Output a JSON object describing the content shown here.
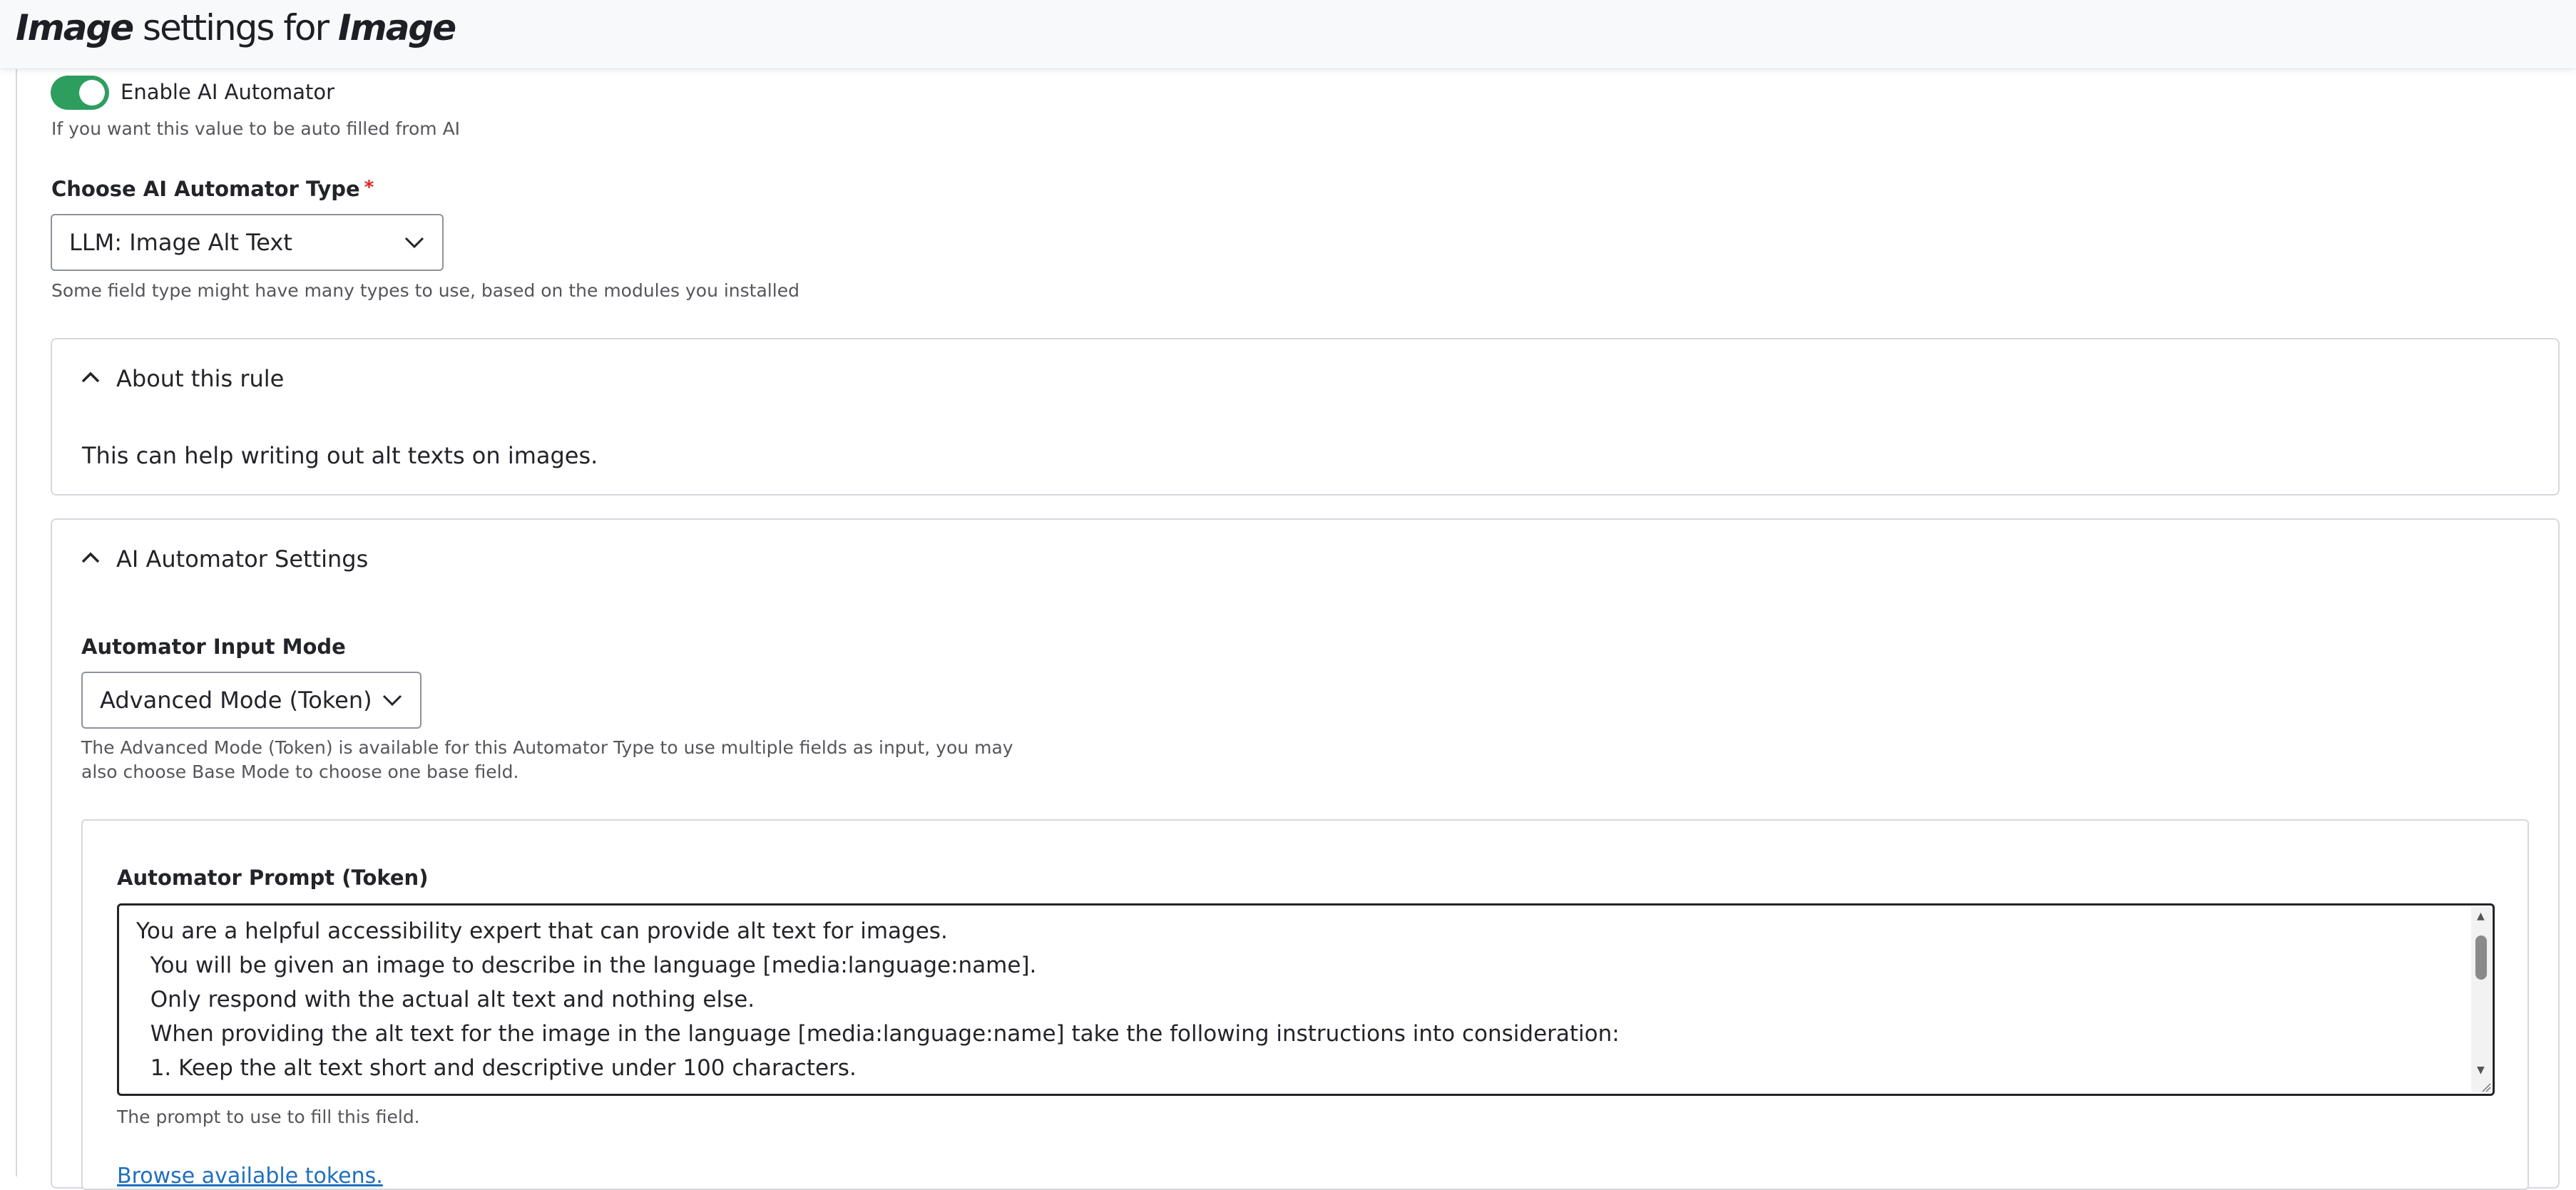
{
  "header": {
    "title_part1": "Image",
    "title_part2": " settings for ",
    "title_part3": "Image"
  },
  "toggle": {
    "label": "Enable AI Automator",
    "state": "on",
    "description": "If you want this value to be auto filled from AI",
    "accent_color": "#2e9e5f"
  },
  "automator_type": {
    "label": "Choose AI Automator Type",
    "required_mark": "*",
    "value": "LLM: Image Alt Text",
    "description": "Some field type might have many types to use, based on the modules you installed"
  },
  "about_rule": {
    "title": "About this rule",
    "body": "This can help writing out alt texts on images."
  },
  "settings": {
    "title": "AI Automator Settings",
    "input_mode_label": "Automator Input Mode",
    "input_mode_value": "Advanced Mode (Token)",
    "input_mode_description_line1": "The Advanced Mode (Token) is available for this Automator Type to use multiple fields as input, you may",
    "input_mode_description_line2": "also choose Base Mode to choose one base field.",
    "prompt_label": "Automator Prompt (Token)",
    "prompt_lines": [
      "You are a helpful accessibility expert that can provide alt text for images.",
      "  You will be given an image to describe in the language [media:language:name].",
      "  Only respond with the actual alt text and nothing else.",
      "  When providing the alt text for the image in the language [media:language:name] take the following instructions into consideration:",
      "  1. Keep the alt text short and descriptive under 100 characters."
    ],
    "prompt_description": "The prompt to use to fill this field.",
    "browse_tokens_link": "Browse available tokens."
  }
}
